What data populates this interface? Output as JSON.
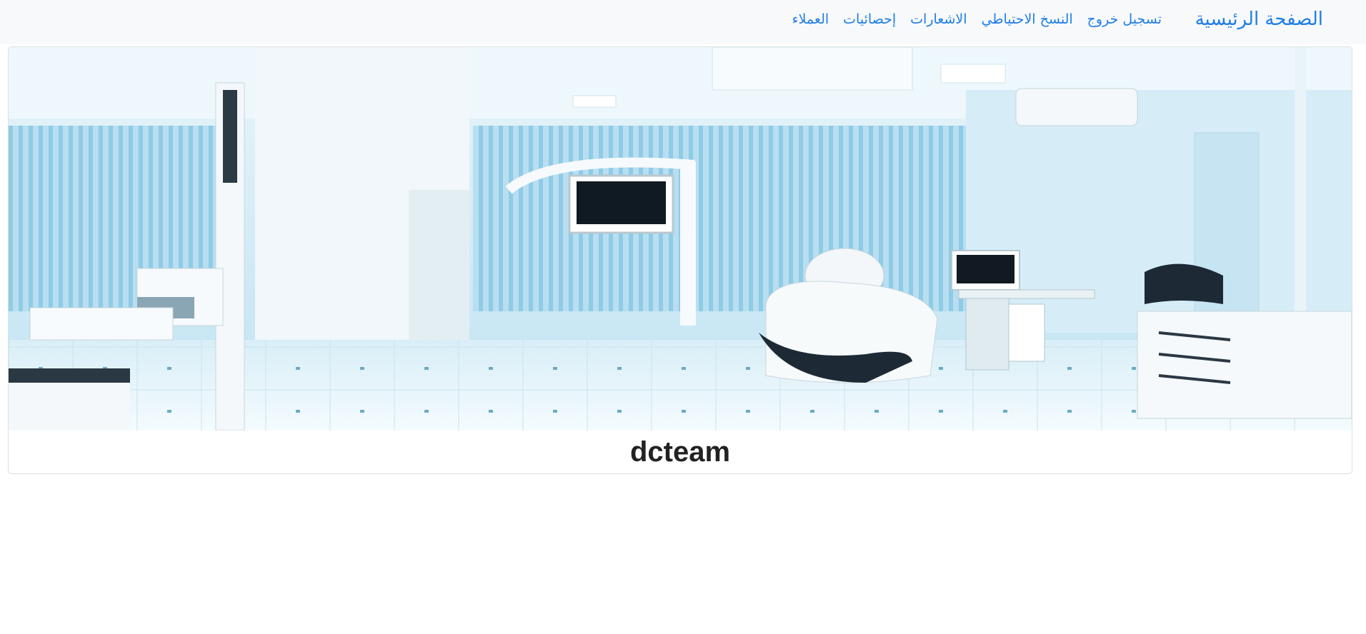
{
  "navbar": {
    "brand": "الصفحة الرئيسية",
    "links": [
      "العملاء",
      "إحصائيات",
      "الاشعارات",
      "النسخ الاحتياطي",
      "تسجيل خروج"
    ]
  },
  "card": {
    "image_alt": "dental-clinic-room",
    "title": "dcteam"
  },
  "colors": {
    "link": "#1f7ee6",
    "navbar_bg": "#f8f9fa"
  }
}
